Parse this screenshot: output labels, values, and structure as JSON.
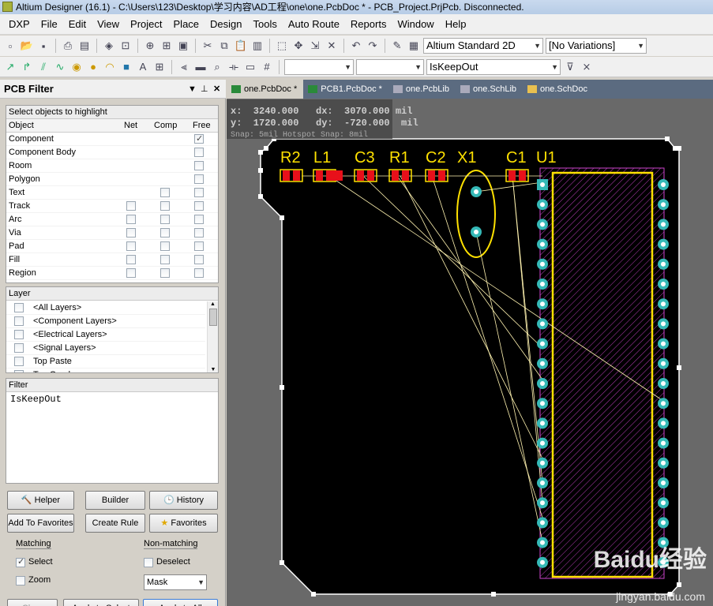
{
  "window": {
    "title": "Altium Designer (16.1) - C:\\Users\\123\\Desktop\\学习内容\\AD工程\\one\\one.PcbDoc * - PCB_Project.PrjPcb. Disconnected."
  },
  "menu": [
    "DXP",
    "File",
    "Edit",
    "View",
    "Project",
    "Place",
    "Design",
    "Tools",
    "Auto Route",
    "Reports",
    "Window",
    "Help"
  ],
  "toolbar": {
    "view_combo": "Altium Standard 2D",
    "variations_combo": "[No Variations]",
    "query_combo": "IsKeepOut"
  },
  "panel": {
    "title": "PCB Filter",
    "objects_section_title": "Select objects to highlight",
    "columns": [
      "Object",
      "Net",
      "Comp",
      "Free"
    ],
    "objects": [
      {
        "name": "Component",
        "net": null,
        "comp": null,
        "free": true
      },
      {
        "name": "Component Body",
        "net": null,
        "comp": null,
        "free": false
      },
      {
        "name": "Room",
        "net": null,
        "comp": null,
        "free": false
      },
      {
        "name": "Polygon",
        "net": null,
        "comp": null,
        "free": false
      },
      {
        "name": "Text",
        "net": null,
        "comp": false,
        "free": false
      },
      {
        "name": "Track",
        "net": false,
        "comp": false,
        "free": false
      },
      {
        "name": "Arc",
        "net": false,
        "comp": false,
        "free": false
      },
      {
        "name": "Via",
        "net": false,
        "comp": false,
        "free": false
      },
      {
        "name": "Pad",
        "net": false,
        "comp": false,
        "free": false
      },
      {
        "name": "Fill",
        "net": false,
        "comp": false,
        "free": false
      },
      {
        "name": "Region",
        "net": false,
        "comp": false,
        "free": false
      }
    ],
    "layer_title": "Layer",
    "layers": [
      "<All Layers>",
      "<Component Layers>",
      "<Electrical Layers>",
      "<Signal Layers>",
      "Top Paste",
      "Top Overlay"
    ],
    "filter_title": "Filter",
    "filter_text": "IsKeepOut",
    "buttons": {
      "helper": "Helper",
      "builder": "Builder",
      "history": "History",
      "add_favorites": "Add To Favorites",
      "create_rule": "Create Rule",
      "favorites": "Favorites",
      "clear": "Clear",
      "apply_select": "Apply to Select",
      "apply_all": "Apply to All"
    },
    "matching_title": "Matching",
    "select_label": "Select",
    "select_checked": true,
    "zoom_label": "Zoom",
    "zoom_checked": false,
    "nonmatching_title": "Non-matching",
    "deselect_label": "Deselect",
    "deselect_checked": false,
    "mask_value": "Mask"
  },
  "tabs": [
    "one.PcbDoc *",
    "PCB1.PcbDoc *",
    "one.PcbLib",
    "one.SchLib",
    "one.SchDoc"
  ],
  "hud": {
    "line1": "x:  3240.000   dx:  3070.000 mil",
    "line2": "y:  1720.000   dy:  -720.000  mil",
    "snap": "Snap: 5mil Hotspot Snap: 8mil"
  },
  "designators": [
    "R2",
    "L1",
    "C3",
    "R1",
    "C2",
    "X1",
    "C1",
    "U1"
  ],
  "watermark": {
    "brand": "Baidu经验",
    "url": "jingyan.baidu.com"
  },
  "colors": {
    "board": "#000000",
    "designator": "#ffe100",
    "pad": "#e8101a",
    "via_ring": "#35b9b7",
    "ratsnest": "#fff3b0",
    "courtyard": "#cc44cc"
  }
}
